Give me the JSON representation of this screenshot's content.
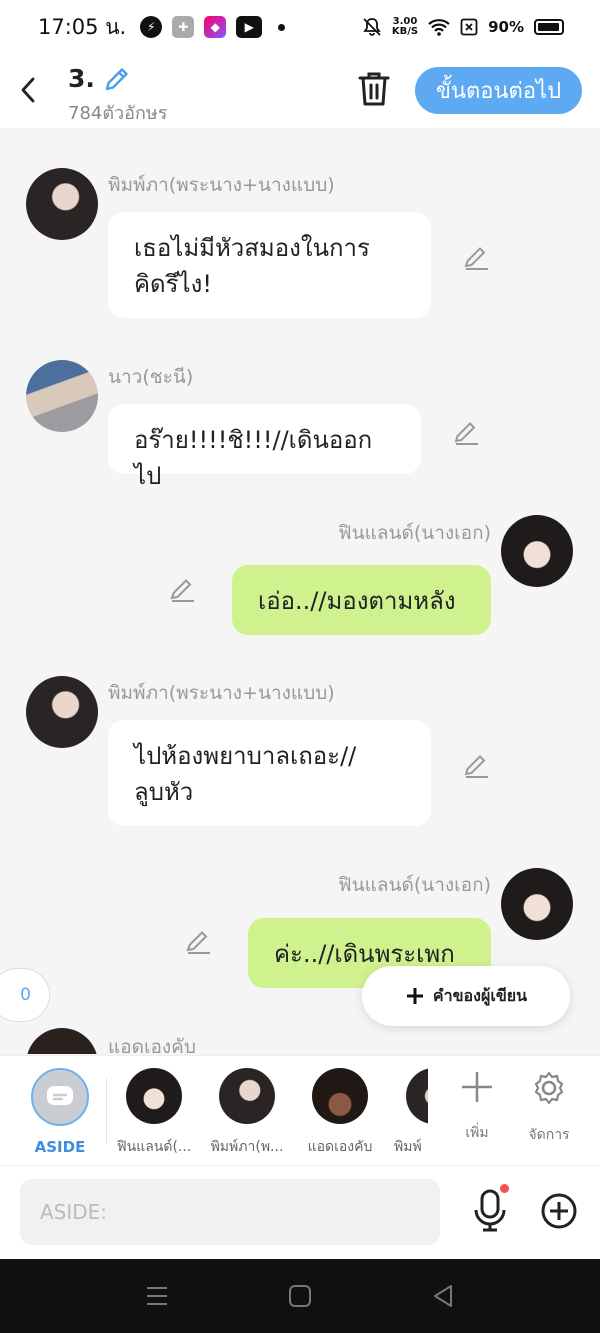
{
  "status_bar": {
    "time": "17:05 น.",
    "net_speed_value": "3.00",
    "net_speed_unit": "KB/S",
    "battery_percent": "90%"
  },
  "header": {
    "episode_title": "3.",
    "char_count": "784ตัวอักษร",
    "next_button": "ขั้นตอนต่อไป"
  },
  "messages": [
    {
      "side": "left",
      "name": "พิมพ์ภา(พระนาง+นางแบบ)",
      "lines": [
        "เธอไม่มีหัวสมองในการ",
        "คิดรึไง!"
      ]
    },
    {
      "side": "left",
      "name": "นาว(ชะนี)",
      "lines": [
        "อร๊าย!!!!ชิ!!!//เดินออกไป"
      ]
    },
    {
      "side": "right",
      "name": "ฟินแลนด์(นางเอก)",
      "lines": [
        "เอ่อ..//มองตามหลัง"
      ]
    },
    {
      "side": "left",
      "name": "พิมพ์ภา(พระนาง+นางแบบ)",
      "lines": [
        "ไปห้องพยาบาลเถอะ//",
        "ลูบหัว"
      ]
    },
    {
      "side": "right",
      "name": "ฟินแลนด์(นางเอก)",
      "lines": [
        "ค่ะ..//เดินพระเพก"
      ]
    },
    {
      "side": "left",
      "name": "แอดเองคับ",
      "lines": []
    }
  ],
  "floating": {
    "counter": "0",
    "narration_button": "คำของผู้เขียน"
  },
  "char_bar": {
    "aside_label": "ASIDE",
    "characters": [
      "ฟินแลนด์(...",
      "พิมพ์ภา(พ...",
      "แอดเองคับ",
      "พิมพ์"
    ],
    "add_label": "เพิ่ม",
    "manage_label": "จัดการ"
  },
  "input": {
    "placeholder": "ASIDE:"
  },
  "colors": {
    "accent": "#5eaaf2",
    "bubble_right": "#cff28e",
    "bubble_left": "#ffffff",
    "background": "#f5f5f5"
  }
}
